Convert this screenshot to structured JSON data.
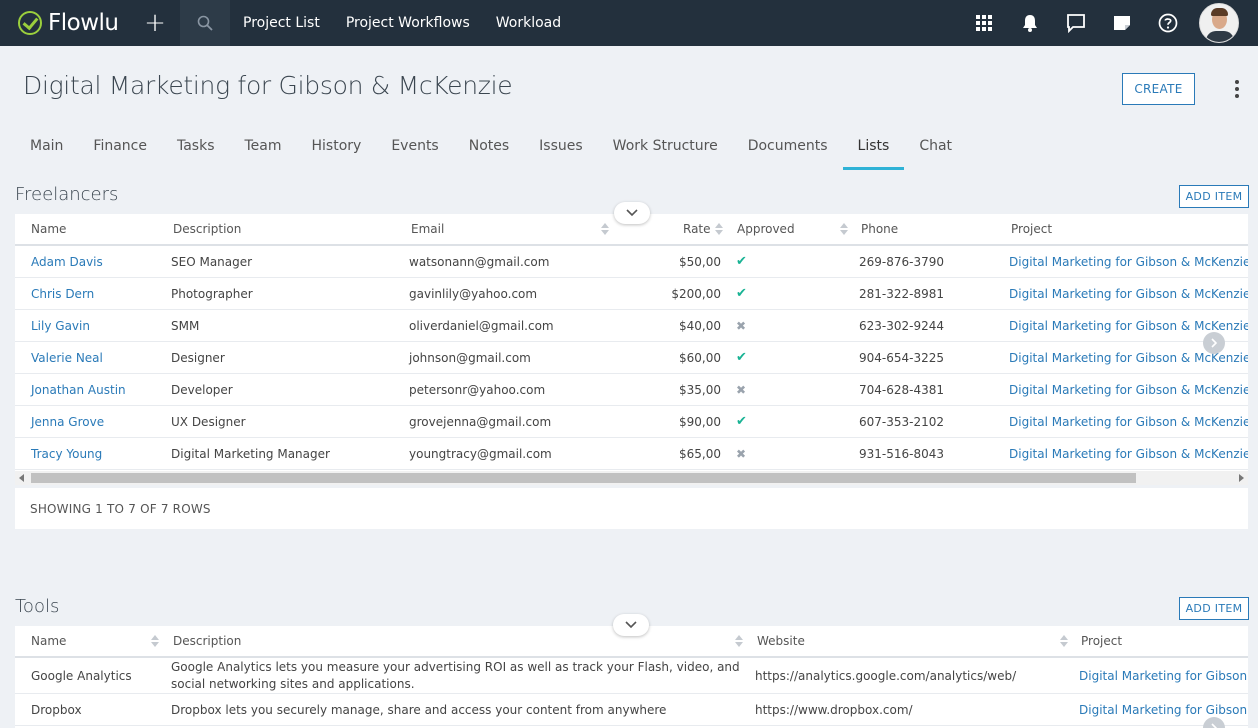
{
  "app": {
    "name": "Flowlu",
    "nav": [
      "Project List",
      "Project Workflows",
      "Workload"
    ]
  },
  "header": {
    "title": "Digital Marketing for Gibson & McKenzie",
    "create_label": "CREATE"
  },
  "tabs": [
    "Main",
    "Finance",
    "Tasks",
    "Team",
    "History",
    "Events",
    "Notes",
    "Issues",
    "Work Structure",
    "Documents",
    "Lists",
    "Chat"
  ],
  "active_tab": "Lists",
  "freelancers": {
    "title": "Freelancers",
    "add_label": "ADD ITEM",
    "columns": [
      "Name",
      "Description",
      "Email",
      "Rate",
      "Approved",
      "Phone",
      "Project"
    ],
    "rows": [
      {
        "name": "Adam Davis",
        "description": "SEO Manager",
        "email": "watsonann@gmail.com",
        "rate": "$50,00",
        "approved": "✔",
        "phone": "269-876-3790",
        "project": "Digital Marketing for Gibson & McKenzie"
      },
      {
        "name": "Chris Dern",
        "description": "Photographer",
        "email": "gavinlily@yahoo.com",
        "rate": "$200,00",
        "approved": "✔",
        "phone": "281-322-8981",
        "project": "Digital Marketing for Gibson & McKenzie"
      },
      {
        "name": "Lily Gavin",
        "description": "SMM",
        "email": "oliverdaniel@gmail.com",
        "rate": "$40,00",
        "approved": "✖",
        "phone": "623-302-9244",
        "project": "Digital Marketing for Gibson & McKenzie"
      },
      {
        "name": "Valerie Neal",
        "description": "Designer",
        "email": "johnson@gmail.com",
        "rate": "$60,00",
        "approved": "✔",
        "phone": "904-654-3225",
        "project": "Digital Marketing for Gibson & McKenzie"
      },
      {
        "name": "Jonathan Austin",
        "description": "Developer",
        "email": "petersonr@yahoo.com",
        "rate": "$35,00",
        "approved": "✖",
        "phone": "704-628-4381",
        "project": "Digital Marketing for Gibson & McKenzie"
      },
      {
        "name": "Jenna Grove",
        "description": "UX Designer",
        "email": "grovejenna@gmail.com",
        "rate": "$90,00",
        "approved": "✔",
        "phone": "607-353-2102",
        "project": "Digital Marketing for Gibson & McKenzie"
      },
      {
        "name": "Tracy Young",
        "description": "Digital Marketing Manager",
        "email": "youngtracy@gmail.com",
        "rate": "$65,00",
        "approved": "✖",
        "phone": "931-516-8043",
        "project": "Digital Marketing for Gibson & McKenzie"
      }
    ],
    "footer": "SHOWING 1 TO 7 OF 7 ROWS"
  },
  "tools": {
    "title": "Tools",
    "add_label": "ADD ITEM",
    "columns": [
      "Name",
      "Description",
      "Website",
      "Project"
    ],
    "rows": [
      {
        "name": "Google Analytics",
        "description": "Google Analytics lets you measure your advertising ROI as well as track your Flash, video, and social networking sites and applications.",
        "website": "https://analytics.google.com/analytics/web/",
        "project": "Digital Marketing for Gibson &"
      },
      {
        "name": "Dropbox",
        "description": "Dropbox lets you securely manage, share and access your content from anywhere",
        "website": "https://www.dropbox.com/",
        "project": "Digital Marketing for Gibson &"
      }
    ]
  },
  "colors": {
    "topbar": "#23303d",
    "accent": "#2a7ab8",
    "tab_active": "#2eb2d6",
    "approved": "#19b394",
    "logo": "#9bcf3d"
  }
}
